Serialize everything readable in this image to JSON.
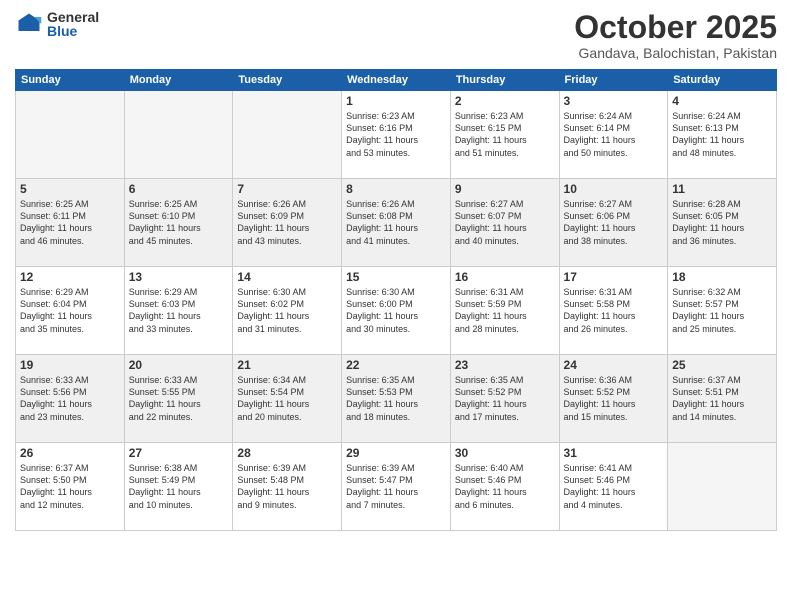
{
  "logo": {
    "general": "General",
    "blue": "Blue"
  },
  "header": {
    "month": "October 2025",
    "location": "Gandava, Balochistan, Pakistan"
  },
  "weekdays": [
    "Sunday",
    "Monday",
    "Tuesday",
    "Wednesday",
    "Thursday",
    "Friday",
    "Saturday"
  ],
  "weeks": [
    [
      {
        "day": "",
        "info": ""
      },
      {
        "day": "",
        "info": ""
      },
      {
        "day": "",
        "info": ""
      },
      {
        "day": "1",
        "info": "Sunrise: 6:23 AM\nSunset: 6:16 PM\nDaylight: 11 hours\nand 53 minutes."
      },
      {
        "day": "2",
        "info": "Sunrise: 6:23 AM\nSunset: 6:15 PM\nDaylight: 11 hours\nand 51 minutes."
      },
      {
        "day": "3",
        "info": "Sunrise: 6:24 AM\nSunset: 6:14 PM\nDaylight: 11 hours\nand 50 minutes."
      },
      {
        "day": "4",
        "info": "Sunrise: 6:24 AM\nSunset: 6:13 PM\nDaylight: 11 hours\nand 48 minutes."
      }
    ],
    [
      {
        "day": "5",
        "info": "Sunrise: 6:25 AM\nSunset: 6:11 PM\nDaylight: 11 hours\nand 46 minutes."
      },
      {
        "day": "6",
        "info": "Sunrise: 6:25 AM\nSunset: 6:10 PM\nDaylight: 11 hours\nand 45 minutes."
      },
      {
        "day": "7",
        "info": "Sunrise: 6:26 AM\nSunset: 6:09 PM\nDaylight: 11 hours\nand 43 minutes."
      },
      {
        "day": "8",
        "info": "Sunrise: 6:26 AM\nSunset: 6:08 PM\nDaylight: 11 hours\nand 41 minutes."
      },
      {
        "day": "9",
        "info": "Sunrise: 6:27 AM\nSunset: 6:07 PM\nDaylight: 11 hours\nand 40 minutes."
      },
      {
        "day": "10",
        "info": "Sunrise: 6:27 AM\nSunset: 6:06 PM\nDaylight: 11 hours\nand 38 minutes."
      },
      {
        "day": "11",
        "info": "Sunrise: 6:28 AM\nSunset: 6:05 PM\nDaylight: 11 hours\nand 36 minutes."
      }
    ],
    [
      {
        "day": "12",
        "info": "Sunrise: 6:29 AM\nSunset: 6:04 PM\nDaylight: 11 hours\nand 35 minutes."
      },
      {
        "day": "13",
        "info": "Sunrise: 6:29 AM\nSunset: 6:03 PM\nDaylight: 11 hours\nand 33 minutes."
      },
      {
        "day": "14",
        "info": "Sunrise: 6:30 AM\nSunset: 6:02 PM\nDaylight: 11 hours\nand 31 minutes."
      },
      {
        "day": "15",
        "info": "Sunrise: 6:30 AM\nSunset: 6:00 PM\nDaylight: 11 hours\nand 30 minutes."
      },
      {
        "day": "16",
        "info": "Sunrise: 6:31 AM\nSunset: 5:59 PM\nDaylight: 11 hours\nand 28 minutes."
      },
      {
        "day": "17",
        "info": "Sunrise: 6:31 AM\nSunset: 5:58 PM\nDaylight: 11 hours\nand 26 minutes."
      },
      {
        "day": "18",
        "info": "Sunrise: 6:32 AM\nSunset: 5:57 PM\nDaylight: 11 hours\nand 25 minutes."
      }
    ],
    [
      {
        "day": "19",
        "info": "Sunrise: 6:33 AM\nSunset: 5:56 PM\nDaylight: 11 hours\nand 23 minutes."
      },
      {
        "day": "20",
        "info": "Sunrise: 6:33 AM\nSunset: 5:55 PM\nDaylight: 11 hours\nand 22 minutes."
      },
      {
        "day": "21",
        "info": "Sunrise: 6:34 AM\nSunset: 5:54 PM\nDaylight: 11 hours\nand 20 minutes."
      },
      {
        "day": "22",
        "info": "Sunrise: 6:35 AM\nSunset: 5:53 PM\nDaylight: 11 hours\nand 18 minutes."
      },
      {
        "day": "23",
        "info": "Sunrise: 6:35 AM\nSunset: 5:52 PM\nDaylight: 11 hours\nand 17 minutes."
      },
      {
        "day": "24",
        "info": "Sunrise: 6:36 AM\nSunset: 5:52 PM\nDaylight: 11 hours\nand 15 minutes."
      },
      {
        "day": "25",
        "info": "Sunrise: 6:37 AM\nSunset: 5:51 PM\nDaylight: 11 hours\nand 14 minutes."
      }
    ],
    [
      {
        "day": "26",
        "info": "Sunrise: 6:37 AM\nSunset: 5:50 PM\nDaylight: 11 hours\nand 12 minutes."
      },
      {
        "day": "27",
        "info": "Sunrise: 6:38 AM\nSunset: 5:49 PM\nDaylight: 11 hours\nand 10 minutes."
      },
      {
        "day": "28",
        "info": "Sunrise: 6:39 AM\nSunset: 5:48 PM\nDaylight: 11 hours\nand 9 minutes."
      },
      {
        "day": "29",
        "info": "Sunrise: 6:39 AM\nSunset: 5:47 PM\nDaylight: 11 hours\nand 7 minutes."
      },
      {
        "day": "30",
        "info": "Sunrise: 6:40 AM\nSunset: 5:46 PM\nDaylight: 11 hours\nand 6 minutes."
      },
      {
        "day": "31",
        "info": "Sunrise: 6:41 AM\nSunset: 5:46 PM\nDaylight: 11 hours\nand 4 minutes."
      },
      {
        "day": "",
        "info": ""
      }
    ]
  ]
}
